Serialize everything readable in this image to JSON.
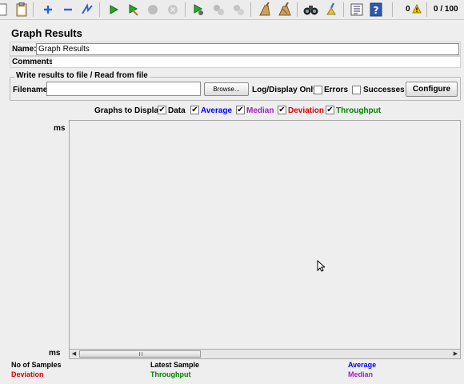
{
  "counters": {
    "errors": "0",
    "threads": "0 / 100"
  },
  "panel": {
    "title": "Graph Results"
  },
  "name_row": {
    "label": "Name:",
    "value": "Graph Results"
  },
  "comments_row": {
    "label": "Comments:"
  },
  "file_group": {
    "title": "Write results to file / Read from file",
    "filename_label": "Filename",
    "filename_value": "",
    "browse_label": "Browse...",
    "log_display_label": "Log/Display Only:",
    "errors_label": "Errors",
    "successes_label": "Successes",
    "configure_label": "Configure"
  },
  "graphs": {
    "label": "Graphs to Display",
    "items": [
      {
        "label": "Data",
        "color": "#000000",
        "checked": true
      },
      {
        "label": "Average",
        "color": "#0000ff",
        "checked": true
      },
      {
        "label": "Median",
        "color": "#a020c0",
        "checked": true
      },
      {
        "label": "Deviation",
        "color": "#e00000",
        "checked": true
      },
      {
        "label": "Throughput",
        "color": "#008000",
        "checked": true
      }
    ]
  },
  "axis": {
    "top_unit": "ms",
    "bottom_unit": "ms"
  },
  "footer": {
    "no_of_samples": "No of Samples",
    "deviation": "Deviation",
    "latest_sample": "Latest Sample",
    "throughput": "Throughput",
    "average": "Average",
    "median": "Median"
  },
  "colors": {
    "average": "#0000ff",
    "median": "#a020c0",
    "deviation": "#e00000",
    "throughput": "#008000"
  }
}
